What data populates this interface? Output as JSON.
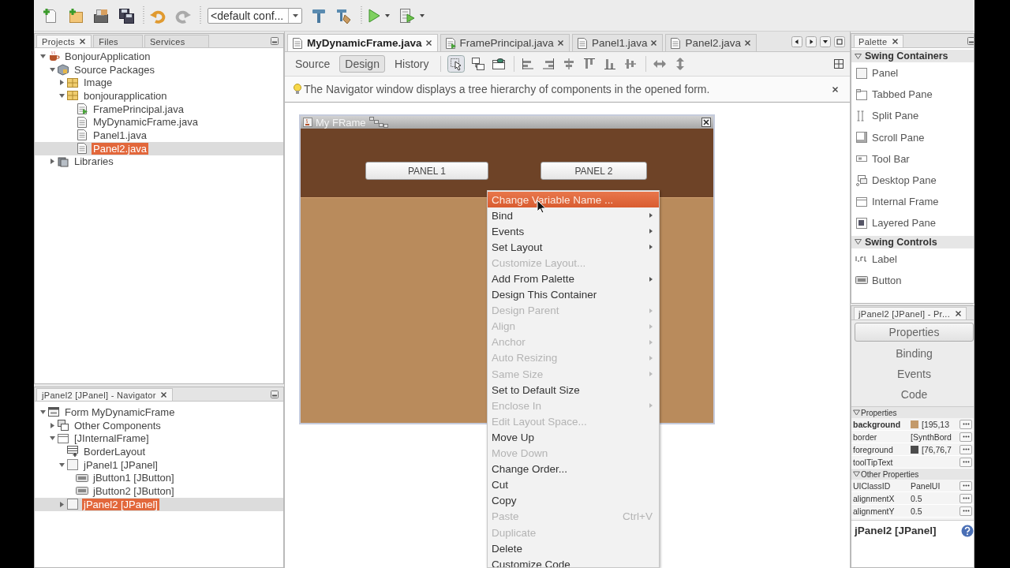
{
  "toolbar": {
    "config_combo": "<default conf..."
  },
  "projects_panel": {
    "tabs": [
      {
        "label": "Projects",
        "selected": true
      },
      {
        "label": "Files",
        "selected": false
      },
      {
        "label": "Services",
        "selected": false
      }
    ],
    "tree": [
      {
        "label": "BonjourApplication",
        "kind": "project",
        "expanded": true,
        "selected": false,
        "children": [
          {
            "label": "Source Packages",
            "kind": "sources",
            "expanded": true,
            "selected": false,
            "children": [
              {
                "label": "Image",
                "kind": "package",
                "expanded": false,
                "selected": false
              },
              {
                "label": "bonjourapplication",
                "kind": "package",
                "expanded": true,
                "selected": false,
                "children": [
                  {
                    "label": "FramePrincipal.java",
                    "kind": "main-class",
                    "selected": false
                  },
                  {
                    "label": "MyDynamicFrame.java",
                    "kind": "form-file",
                    "selected": false
                  },
                  {
                    "label": "Panel1.java",
                    "kind": "form-file",
                    "selected": false
                  },
                  {
                    "label": "Panel2.java",
                    "kind": "form-file",
                    "selected": true
                  }
                ]
              }
            ]
          },
          {
            "label": "Libraries",
            "kind": "libraries",
            "expanded": false,
            "selected": false
          }
        ]
      }
    ]
  },
  "navigator": {
    "title": "jPanel2 [JPanel] - Navigator",
    "tree": [
      {
        "label": "Form MyDynamicFrame",
        "kind": "form",
        "expanded": true,
        "selected": false,
        "children": [
          {
            "label": "Other Components",
            "kind": "other",
            "expanded": false,
            "selected": false
          },
          {
            "label": "[JInternalFrame]",
            "kind": "frame",
            "expanded": true,
            "selected": false,
            "children": [
              {
                "label": "BorderLayout",
                "kind": "layout",
                "selected": false
              },
              {
                "label": "jPanel1 [JPanel]",
                "kind": "panel",
                "expanded": true,
                "selected": false,
                "children": [
                  {
                    "label": "jButton1 [JButton]",
                    "kind": "button",
                    "selected": false
                  },
                  {
                    "label": "jButton2 [JButton]",
                    "kind": "button",
                    "selected": false
                  }
                ]
              },
              {
                "label": "jPanel2 [JPanel]",
                "kind": "panel",
                "expanded": false,
                "selected": true
              }
            ]
          }
        ]
      }
    ]
  },
  "editor": {
    "tabs": [
      {
        "label": "MyDynamicFrame.java",
        "kind": "form-file",
        "selected": true
      },
      {
        "label": "FramePrincipal.java",
        "kind": "main-class",
        "selected": false
      },
      {
        "label": "Panel1.java",
        "kind": "form-file",
        "selected": false
      },
      {
        "label": "Panel2.java",
        "kind": "form-file",
        "selected": false
      }
    ],
    "view_tabs": [
      {
        "label": "Source",
        "selected": false
      },
      {
        "label": "Design",
        "selected": true
      },
      {
        "label": "History",
        "selected": false
      }
    ],
    "info": "The Navigator window displays a tree hierarchy of components in the opened form.",
    "form": {
      "title": "My FRame",
      "buttons": [
        "PANEL 1",
        "PANEL 2"
      ]
    }
  },
  "context_menu": {
    "items": [
      {
        "label": "Change Variable Name ...",
        "selected": true,
        "disabled": false,
        "submenu": false
      },
      {
        "label": "Bind",
        "selected": false,
        "disabled": false,
        "submenu": true
      },
      {
        "label": "Events",
        "selected": false,
        "disabled": false,
        "submenu": true
      },
      {
        "label": "Set Layout",
        "selected": false,
        "disabled": false,
        "submenu": true
      },
      {
        "label": "Customize Layout...",
        "selected": false,
        "disabled": true,
        "submenu": false
      },
      {
        "label": "Add From Palette",
        "selected": false,
        "disabled": false,
        "submenu": true
      },
      {
        "label": "Design This Container",
        "selected": false,
        "disabled": false,
        "submenu": false
      },
      {
        "label": "Design Parent",
        "selected": false,
        "disabled": true,
        "submenu": true
      },
      {
        "label": "Align",
        "selected": false,
        "disabled": true,
        "submenu": true
      },
      {
        "label": "Anchor",
        "selected": false,
        "disabled": true,
        "submenu": true
      },
      {
        "label": "Auto Resizing",
        "selected": false,
        "disabled": true,
        "submenu": true
      },
      {
        "label": "Same Size",
        "selected": false,
        "disabled": true,
        "submenu": true
      },
      {
        "label": "Set to Default Size",
        "selected": false,
        "disabled": false,
        "submenu": false
      },
      {
        "label": "Enclose In",
        "selected": false,
        "disabled": true,
        "submenu": true
      },
      {
        "label": "Edit Layout Space...",
        "selected": false,
        "disabled": true,
        "submenu": false
      },
      {
        "label": "Move Up",
        "selected": false,
        "disabled": false,
        "submenu": false
      },
      {
        "label": "Move Down",
        "selected": false,
        "disabled": true,
        "submenu": false
      },
      {
        "label": "Change Order...",
        "selected": false,
        "disabled": false,
        "submenu": false
      },
      {
        "label": "Cut",
        "selected": false,
        "disabled": false,
        "submenu": false
      },
      {
        "label": "Copy",
        "selected": false,
        "disabled": false,
        "submenu": false
      },
      {
        "label": "Paste",
        "selected": false,
        "disabled": true,
        "submenu": false,
        "shortcut": "Ctrl+V"
      },
      {
        "label": "Duplicate",
        "selected": false,
        "disabled": true,
        "submenu": false
      },
      {
        "label": "Delete",
        "selected": false,
        "disabled": false,
        "submenu": false
      },
      {
        "label": "Customize Code",
        "selected": false,
        "disabled": false,
        "submenu": false
      }
    ]
  },
  "palette": {
    "title": "Palette",
    "sections": [
      {
        "title": "Swing Containers",
        "expanded": true,
        "items": [
          {
            "label": "Panel",
            "kind": "panel"
          },
          {
            "label": "Tabbed Pane",
            "kind": "tabbed-pane"
          },
          {
            "label": "Split Pane",
            "kind": "split-pane"
          },
          {
            "label": "Scroll Pane",
            "kind": "scroll-pane"
          },
          {
            "label": "Tool Bar",
            "kind": "tool-bar"
          },
          {
            "label": "Desktop Pane",
            "kind": "desktop-pane"
          },
          {
            "label": "Internal Frame",
            "kind": "internal-frame"
          },
          {
            "label": "Layered Pane",
            "kind": "layered-pane"
          }
        ]
      },
      {
        "title": "Swing Controls",
        "expanded": true,
        "items": [
          {
            "label": "Label",
            "kind": "label"
          },
          {
            "label": "Button",
            "kind": "button"
          }
        ]
      }
    ]
  },
  "properties": {
    "title": "jPanel2 [JPanel] - Pr...",
    "tabs": [
      {
        "label": "Properties",
        "selected": true
      },
      {
        "label": "Binding",
        "selected": false
      },
      {
        "label": "Events",
        "selected": false
      },
      {
        "label": "Code",
        "selected": false
      }
    ],
    "groups": [
      {
        "title": "Properties",
        "expanded": true,
        "rows": [
          {
            "name": "background",
            "modified": true,
            "color": "#c39a6b",
            "value": "[195,13"
          },
          {
            "name": "border",
            "modified": false,
            "value": "[SynthBord"
          },
          {
            "name": "foreground",
            "modified": false,
            "color": "#4c4c4c",
            "value": "[76,76,7"
          },
          {
            "name": "toolTipText",
            "modified": false
          }
        ]
      },
      {
        "title": "Other Properties",
        "expanded": true,
        "rows": [
          {
            "name": "UIClassID",
            "modified": false,
            "value": "PanelUI"
          },
          {
            "name": "alignmentX",
            "modified": false,
            "value": "0.5"
          },
          {
            "name": "alignmentY",
            "modified": false,
            "value": "0.5"
          }
        ]
      }
    ],
    "footer": "jPanel2 [JPanel]"
  }
}
